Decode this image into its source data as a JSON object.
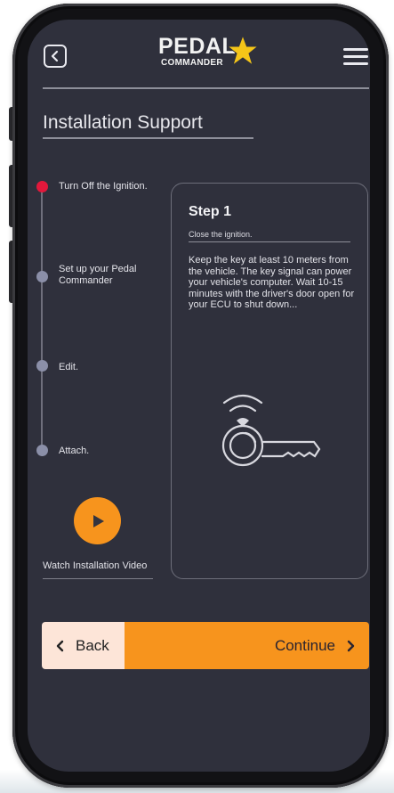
{
  "header": {
    "logo_main": "PEDAL",
    "logo_sub": "COMMANDER"
  },
  "page": {
    "title": "Installation Support"
  },
  "steps": [
    {
      "label": "Turn Off the Ignition.",
      "active": true
    },
    {
      "label": "Set up your Pedal Commander",
      "active": false
    },
    {
      "label": "Edit.",
      "active": false
    },
    {
      "label": "Attach.",
      "active": false
    }
  ],
  "video": {
    "label": "Watch Installation Video"
  },
  "card": {
    "title": "Step 1",
    "subtitle": "Close the ignition.",
    "body": "Keep the key at least 10 meters from the vehicle. The key signal can power your vehicle's computer. Wait 10-15 minutes with the driver's door open for your ECU to shut down...",
    "illustration_icon": "car-key-signal-icon"
  },
  "footer": {
    "back_label": "Back",
    "continue_label": "Continue"
  },
  "colors": {
    "screen_bg": "#2f303c",
    "accent_orange": "#f7941d",
    "active_red": "#e2183b",
    "logo_star": "#f5c518",
    "back_pane": "#fde5d8"
  }
}
